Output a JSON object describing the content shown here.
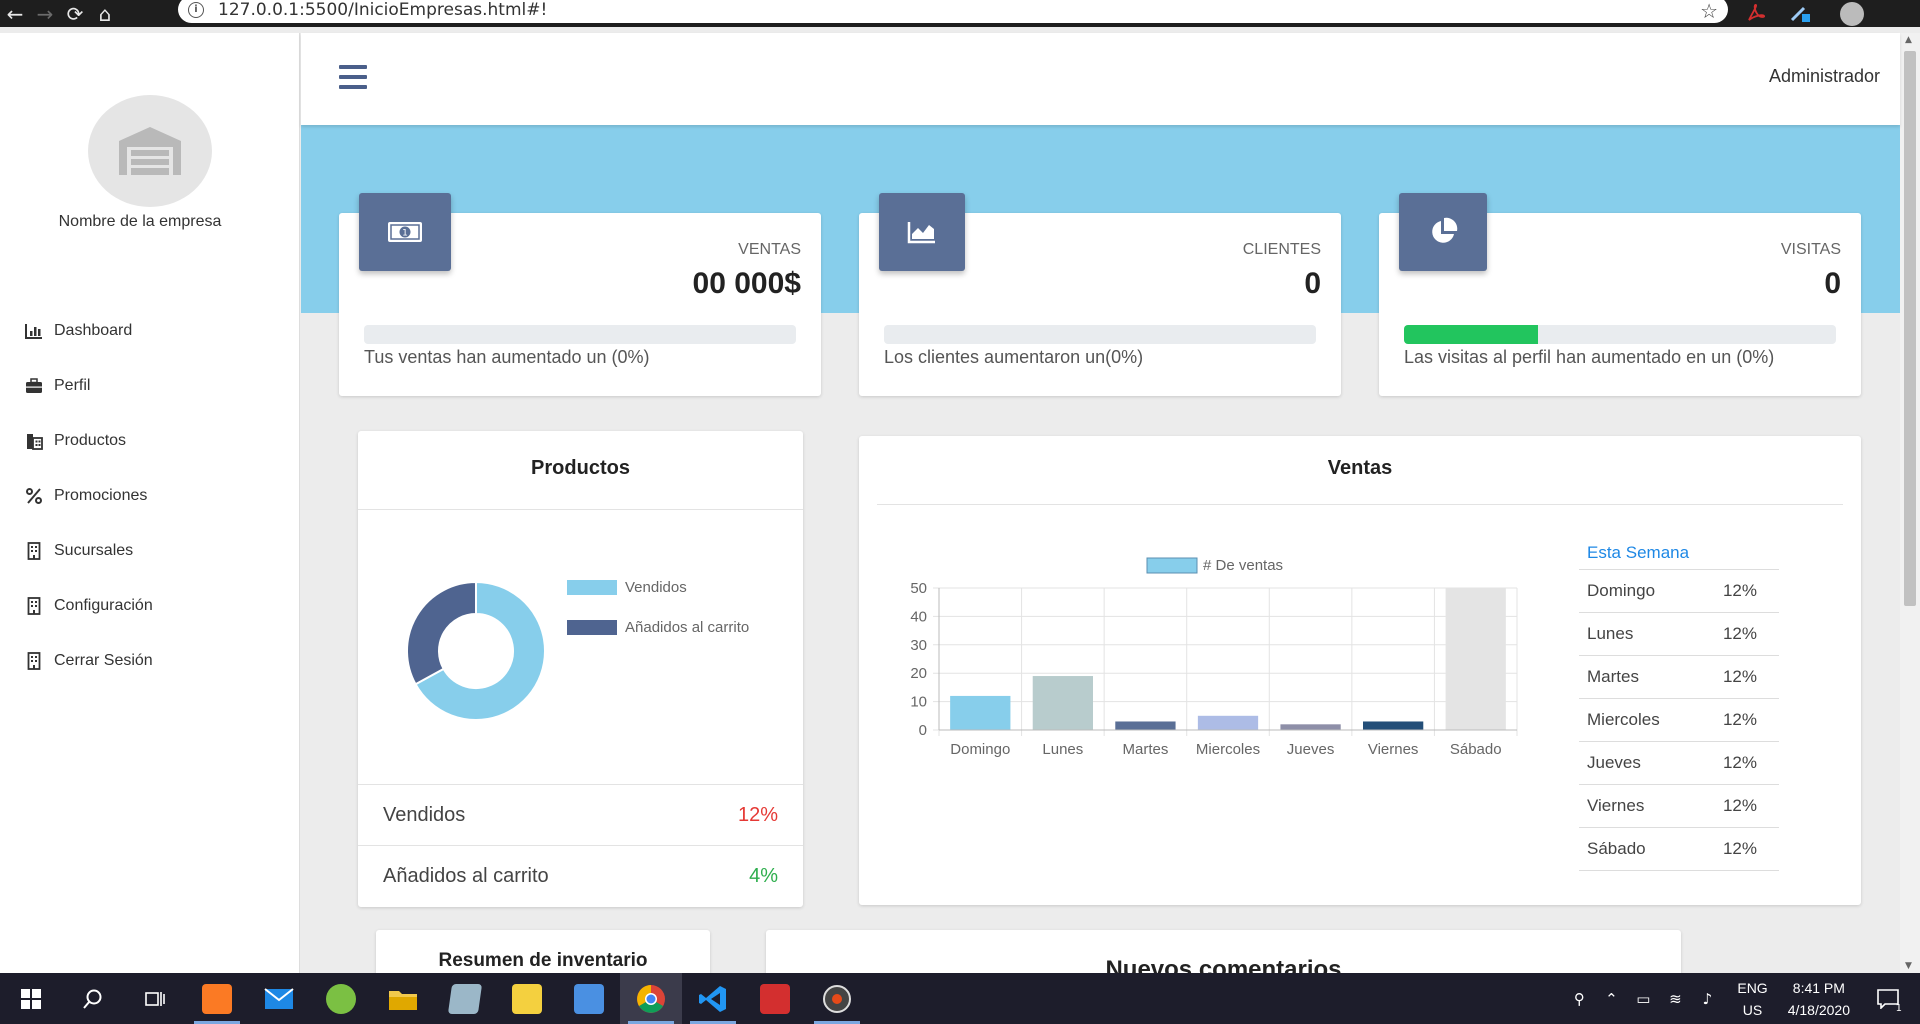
{
  "browser": {
    "url": "127.0.0.1:5500/InicioEmpresas.html#!",
    "back": "←",
    "forward": "→",
    "reload": "⟳",
    "home": "⌂",
    "star": "☆",
    "info": "i"
  },
  "sidebar": {
    "company_name": "Nombre de la empresa",
    "items": [
      {
        "label": "Dashboard",
        "icon": "chart-bar-icon"
      },
      {
        "label": "Perfil",
        "icon": "briefcase-icon"
      },
      {
        "label": "Productos",
        "icon": "building-icon"
      },
      {
        "label": "Promociones",
        "icon": "percent-icon"
      },
      {
        "label": "Sucursales",
        "icon": "building-icon"
      },
      {
        "label": "Configuración",
        "icon": "building-icon"
      },
      {
        "label": "Cerrar Sesión",
        "icon": "building-icon"
      }
    ]
  },
  "header": {
    "user": "Administrador"
  },
  "stats": [
    {
      "label": "VENTAS",
      "value": "00 000$",
      "desc": "Tus ventas han aumentado un (0%)",
      "progress": 0,
      "icon": "money-bill-icon"
    },
    {
      "label": "CLIENTES",
      "value": "0",
      "desc": "Los clientes aumentaron un(0%)",
      "progress": 0,
      "icon": "area-chart-icon"
    },
    {
      "label": "VISITAS",
      "value": "0",
      "desc": "Las visitas al perfil han aumentado en un (0%)",
      "progress": 0.31,
      "icon": "pie-chart-icon"
    }
  ],
  "productos": {
    "title": "Productos",
    "legend": [
      {
        "label": "Vendidos",
        "color": "#87ceeb"
      },
      {
        "label": "Añadidos al carrito",
        "color": "#4f6490"
      }
    ],
    "rows": [
      {
        "label": "Vendidos",
        "value": "12%",
        "color": "#e53935"
      },
      {
        "label": "Añadidos al carrito",
        "value": "4%",
        "color": "#2eae4d"
      }
    ]
  },
  "ventas": {
    "title": "Ventas",
    "week_title": "Esta Semana",
    "week": [
      {
        "day": "Domingo",
        "pct": "12%"
      },
      {
        "day": "Lunes",
        "pct": "12%"
      },
      {
        "day": "Martes",
        "pct": "12%"
      },
      {
        "day": "Miercoles",
        "pct": "12%"
      },
      {
        "day": "Jueves",
        "pct": "12%"
      },
      {
        "day": "Viernes",
        "pct": "12%"
      },
      {
        "day": "Sábado",
        "pct": "12%"
      }
    ]
  },
  "bottom": {
    "inventario_title": "Resumen de inventario",
    "comentarios_title": "Nuevos comentarios"
  },
  "taskbar": {
    "lang": "ENG",
    "region": "US",
    "time": "8:41 PM",
    "date": "4/18/2020",
    "notifications": "1"
  },
  "chart_data": [
    {
      "type": "pie",
      "title": "",
      "labels": [
        "Vendidos",
        "Añadidos al carrito"
      ],
      "values": [
        67,
        33
      ],
      "colors": [
        "#87ceeb",
        "#4f6490"
      ]
    },
    {
      "type": "bar",
      "title": "",
      "categories": [
        "Domingo",
        "Lunes",
        "Martes",
        "Miercoles",
        "Jueves",
        "Viernes",
        "Sábado"
      ],
      "series": [
        {
          "name": "# De ventas",
          "values": [
            12,
            19,
            3,
            5,
            2,
            3,
            50
          ]
        }
      ],
      "colors": [
        "#87ceeb",
        "#b8cccd",
        "#5a6f96",
        "#adbce6",
        "#8e8fa8",
        "#234e78",
        "#e4e4e4"
      ],
      "ylim": [
        0,
        50
      ],
      "yticks": [
        "0",
        "10",
        "20",
        "30",
        "40",
        "50"
      ],
      "grid": true,
      "legend": "top"
    }
  ]
}
